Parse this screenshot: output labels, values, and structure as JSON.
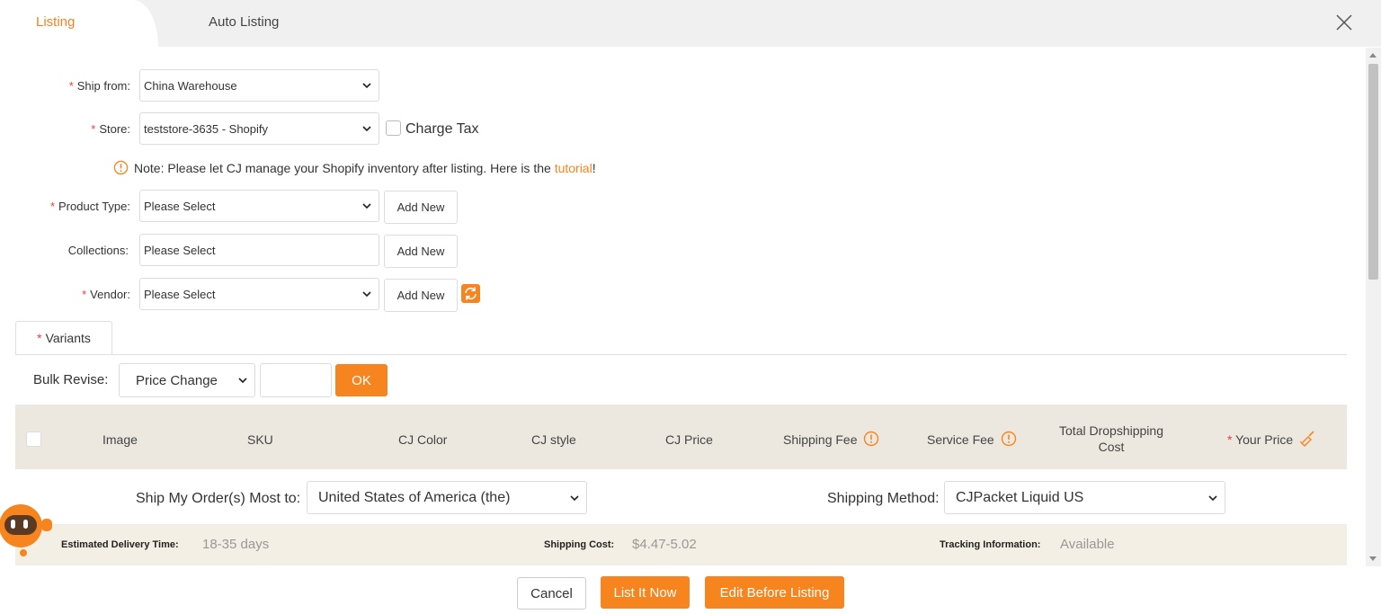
{
  "tabs": {
    "active": "Listing",
    "other": "Auto Listing"
  },
  "form": {
    "required_mark": "*",
    "ship_from": {
      "label": "Ship from:",
      "value": "China Warehouse"
    },
    "store": {
      "label": "Store:",
      "value": "teststore-3635 - Shopify",
      "charge_tax": "Charge Tax"
    },
    "note": {
      "text": "Note: Please let CJ manage your Shopify inventory after listing. Here is the ",
      "link": "tutorial",
      "end": "!"
    },
    "product_type": {
      "label": "Product Type:",
      "value": "Please Select",
      "button": "Add New"
    },
    "collections": {
      "label": "Collections:",
      "value": "Please Select",
      "button": "Add New"
    },
    "vendor": {
      "label": "Vendor:",
      "value": "Please Select",
      "button": "Add New"
    }
  },
  "variants": {
    "tab": "Variants",
    "bulk_label": "Bulk Revise:",
    "bulk_select": "Price Change",
    "ok": "OK",
    "columns": [
      "Image",
      "SKU",
      "CJ Color",
      "CJ style",
      "CJ Price",
      "Shipping Fee",
      "Service Fee",
      "Total Dropshipping",
      "Cost",
      "Your Price"
    ]
  },
  "shipping": {
    "ship_to_label": "Ship My Order(s) Most to:",
    "ship_to_value": "United States of America (the)",
    "method_label": "Shipping Method:",
    "method_value": "CJPacket Liquid US",
    "delivery_key": "Estimated Delivery Time:",
    "delivery_val": "18-35 days",
    "cost_key": "Shipping Cost:",
    "cost_val": "$4.47-5.02",
    "tracking_key": "Tracking Information:",
    "tracking_val": "Available"
  },
  "footer": {
    "cancel": "Cancel",
    "list_now": "List It Now",
    "edit_before": "Edit Before Listing"
  },
  "colors": {
    "accent": "#f6851f",
    "required": "#f03c3c",
    "header_bg": "#ece8e0"
  }
}
